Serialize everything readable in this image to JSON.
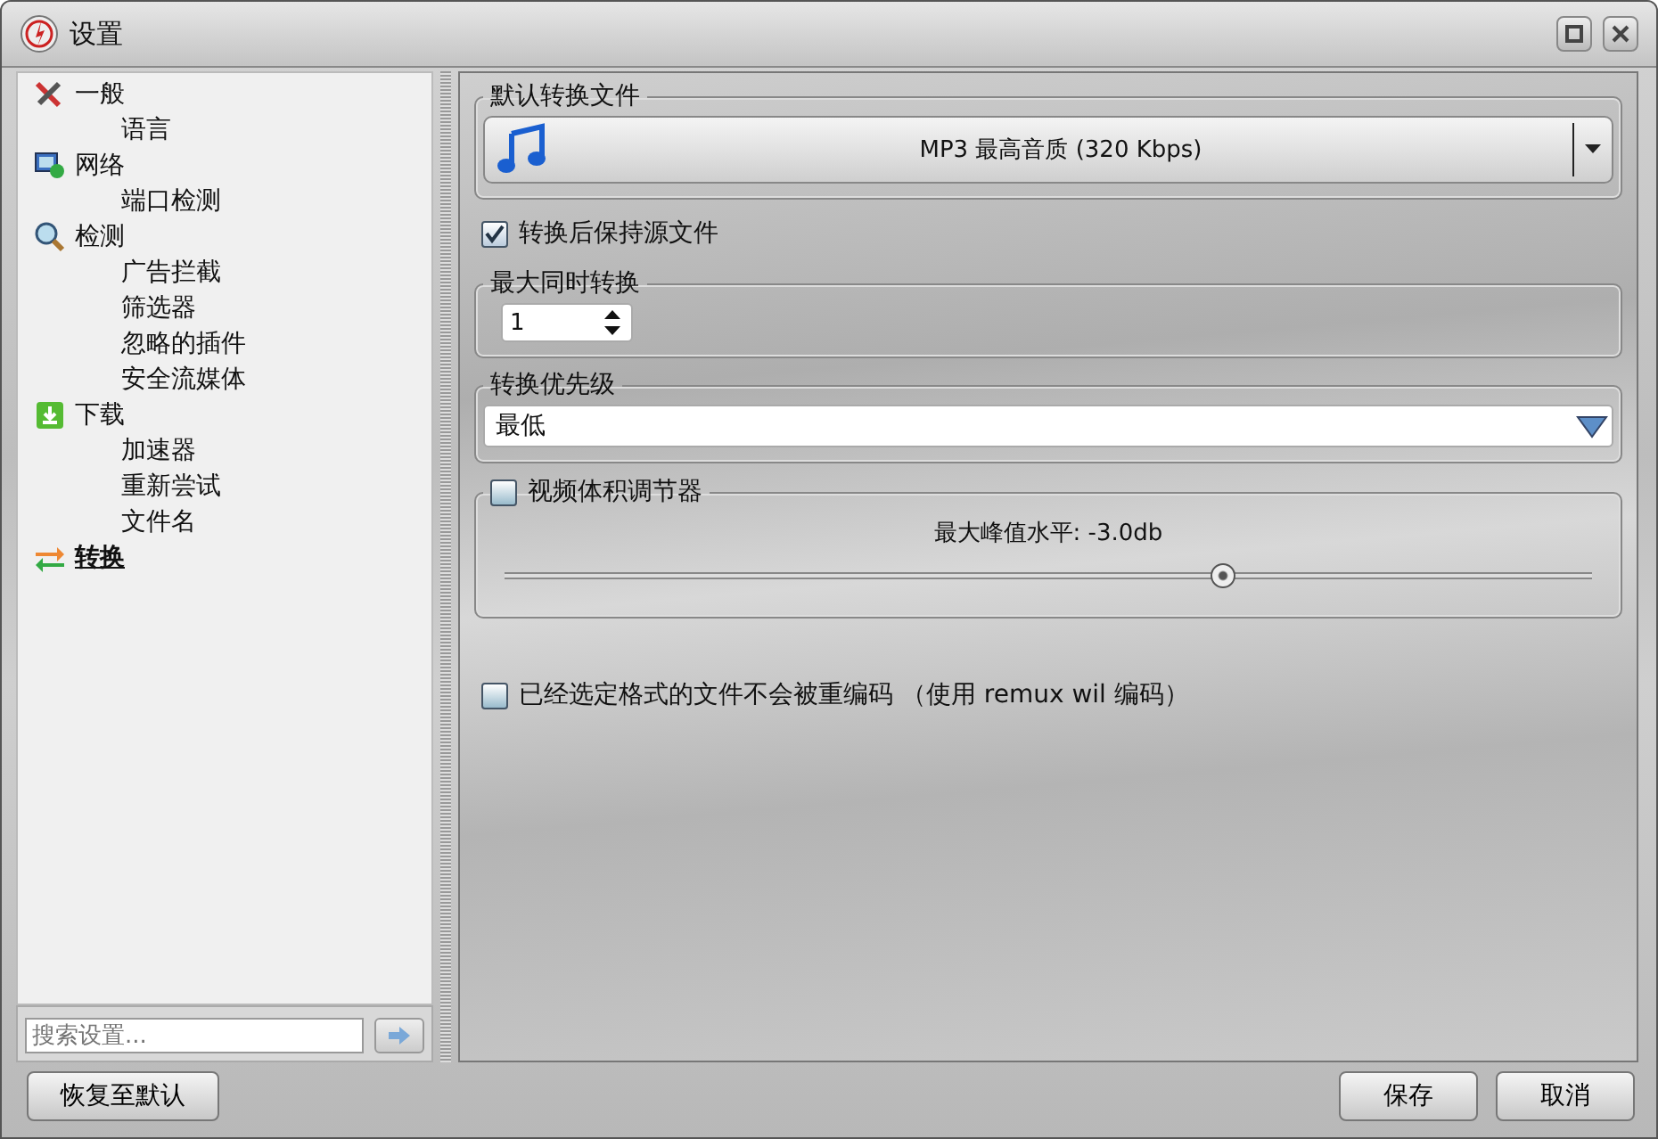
{
  "window": {
    "title": "设置"
  },
  "sidebar": {
    "items": [
      {
        "label": "一般",
        "kind": "tools",
        "selected": false,
        "children": [
          {
            "label": "语言",
            "selected": false
          }
        ]
      },
      {
        "label": "网络",
        "kind": "network",
        "selected": false,
        "children": [
          {
            "label": "端口检测",
            "selected": false
          }
        ]
      },
      {
        "label": "检测",
        "kind": "search",
        "selected": false,
        "children": [
          {
            "label": "广告拦截",
            "selected": false
          },
          {
            "label": "筛选器",
            "selected": false
          },
          {
            "label": "忽略的插件",
            "selected": false
          },
          {
            "label": "安全流媒体",
            "selected": false
          }
        ]
      },
      {
        "label": "下载",
        "kind": "download",
        "selected": false,
        "children": [
          {
            "label": "加速器",
            "selected": false
          },
          {
            "label": "重新尝试",
            "selected": false
          },
          {
            "label": "文件名",
            "selected": false
          }
        ]
      },
      {
        "label": "转换",
        "kind": "convert",
        "selected": true
      }
    ],
    "search": {
      "placeholder": "搜索设置..."
    }
  },
  "default_format": {
    "legend": "默认转换文件",
    "value": "MP3 最高音质 (320 Kbps)"
  },
  "keep_source": {
    "label": "转换后保持源文件",
    "checked": true
  },
  "max_concurrent": {
    "legend": "最大同时转换",
    "value": "1"
  },
  "priority": {
    "legend": "转换优先级",
    "value": "最低"
  },
  "volume": {
    "label": "视频体积调节器",
    "checked": false,
    "reading": "最大峰值水平: -3.0db",
    "level": 0.66
  },
  "no_reencode": {
    "label": "已经选定格式的文件不会被重编码 （使用 remux wil 编码）",
    "checked": false
  },
  "buttons": {
    "reset": "恢复至默认",
    "save": "保存",
    "cancel": "取消"
  }
}
